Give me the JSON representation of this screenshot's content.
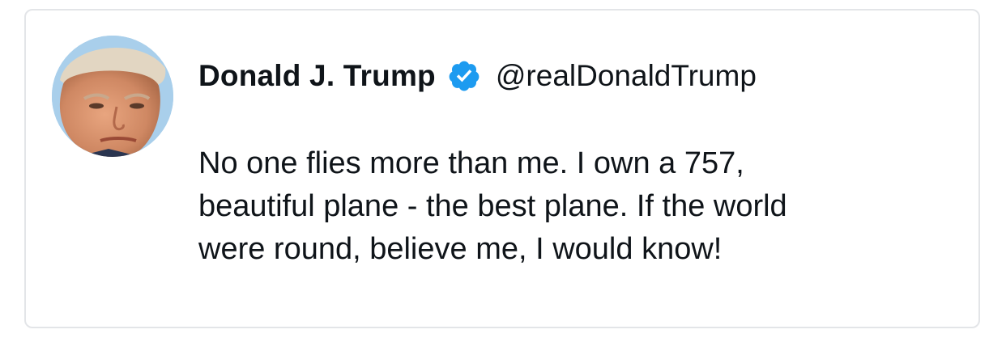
{
  "tweet": {
    "author": {
      "display_name": "Donald J. Trump",
      "handle": "@realDonaldTrump",
      "verified": true,
      "avatar_icon": "profile-photo-icon",
      "verified_icon": "verified-badge-icon",
      "verified_color": "#1d9bf0"
    },
    "text": "No one flies more than me. I own a 757,\nbeautiful plane - the best plane. If the world\nwere round, believe me, I would know!"
  }
}
